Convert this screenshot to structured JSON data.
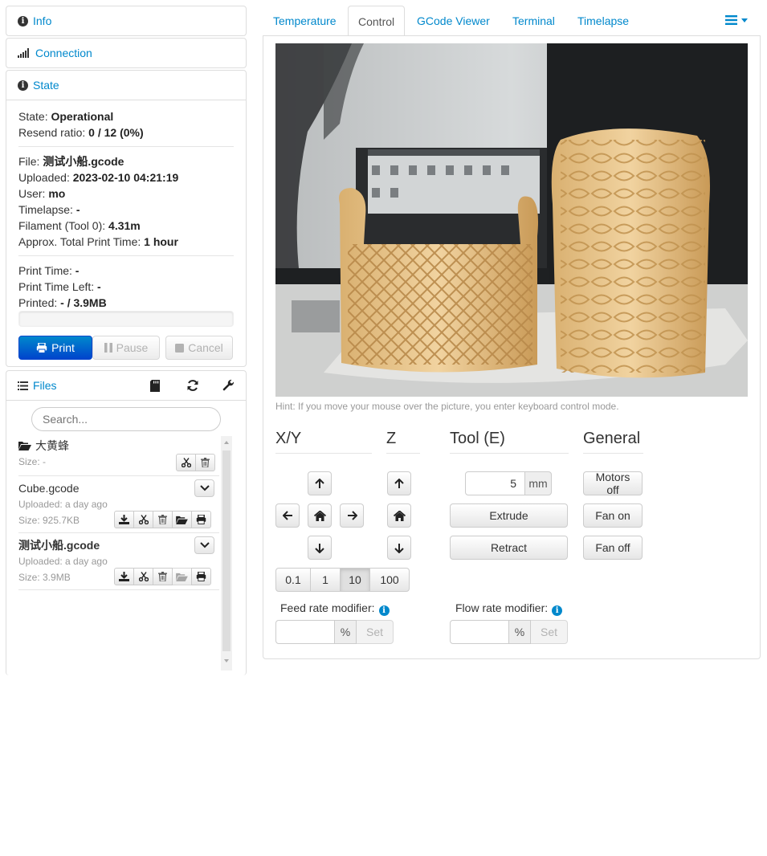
{
  "sidebar": {
    "info": {
      "label": "Info"
    },
    "connection": {
      "label": "Connection"
    },
    "state": {
      "label": "State",
      "state_label": "State:",
      "state_value": "Operational",
      "resend_label": "Resend ratio:",
      "resend_value": "0 / 12 (0%)",
      "file_label": "File:",
      "file_value": "测试小船.gcode",
      "uploaded_label": "Uploaded:",
      "uploaded_value": "2023-02-10 04:21:19",
      "user_label": "User:",
      "user_value": "mo",
      "timelapse_label": "Timelapse:",
      "timelapse_value": "-",
      "filament_label": "Filament (Tool 0):",
      "filament_value": "4.31m",
      "approx_label": "Approx. Total Print Time:",
      "approx_value": "1 hour",
      "print_time_label": "Print Time:",
      "print_time_value": "-",
      "print_left_label": "Print Time Left:",
      "print_left_value": "-",
      "printed_label": "Printed:",
      "printed_value": "- / 3.9MB",
      "progress": 0,
      "buttons": {
        "print": "Print",
        "pause": "Pause",
        "cancel": "Cancel"
      }
    },
    "files": {
      "label": "Files",
      "search_placeholder": "Search...",
      "entries": [
        {
          "name": "大黄蜂",
          "meta1": "Size: -",
          "type": "folder"
        },
        {
          "name": "Cube.gcode",
          "meta1": "Uploaded: a day ago",
          "meta2": "Size: 925.7KB"
        },
        {
          "name": "测试小船.gcode",
          "meta1": "Uploaded: a day ago",
          "meta2": "Size: 3.9MB"
        }
      ]
    }
  },
  "tabs": [
    "Temperature",
    "Control",
    "GCode Viewer",
    "Terminal",
    "Timelapse"
  ],
  "active_tab": "Control",
  "control": {
    "hint": "Hint: If you move your mouse over the picture, you enter keyboard control mode.",
    "sections": {
      "xy": "X/Y",
      "z": "Z",
      "tool": "Tool (E)",
      "general": "General"
    },
    "step_sizes": [
      "0.1",
      "1",
      "10",
      "100"
    ],
    "active_step": "10",
    "extrude_amount": "5",
    "extrude_unit": "mm",
    "extrude_label": "Extrude",
    "retract_label": "Retract",
    "general_buttons": {
      "motors_off": "Motors off",
      "fan_on": "Fan on",
      "fan_off": "Fan off"
    },
    "feed_rate_label": "Feed rate modifier:",
    "flow_rate_label": "Flow rate modifier:",
    "percent": "%",
    "set_label": "Set"
  },
  "colors": {
    "accent": "#0088cc",
    "primary_button": "#0055cc"
  }
}
